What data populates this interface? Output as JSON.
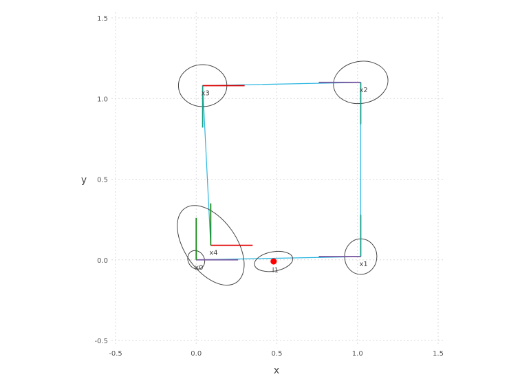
{
  "chart_data": {
    "type": "scatter",
    "title": "",
    "xlabel": "x",
    "ylabel": "y",
    "xlim": [
      -0.5,
      1.5
    ],
    "ylim": [
      -0.5,
      1.5
    ],
    "xticks": [
      -0.5,
      0.0,
      0.5,
      1.0,
      1.5
    ],
    "yticks": [
      -0.5,
      0.0,
      0.5,
      1.0,
      1.5
    ],
    "xtick_labels": [
      "-0.5",
      "0.0",
      "0.5",
      "1.0",
      "1.5"
    ],
    "ytick_labels": [
      "-0.5",
      "0.0",
      "0.5",
      "1.0",
      "1.5"
    ],
    "grid": true,
    "trajectory_color": "#29b6e0",
    "ellipse_color": "#444444",
    "axis_colors": {
      "x_axis": "#e00000",
      "y_axis": "#1a8a1a",
      "blend": "#7a5aa0",
      "teal": "#14a08a"
    },
    "poses": [
      {
        "label": "x0",
        "x": 0.0,
        "y": 0.0,
        "theta_deg": 0,
        "cov_rx": 0.05,
        "cov_ry": 0.06,
        "cov_rot_deg": 30
      },
      {
        "label": "x1",
        "x": 1.02,
        "y": 0.02,
        "theta_deg": 90,
        "cov_rx": 0.1,
        "cov_ry": 0.11,
        "cov_rot_deg": 0
      },
      {
        "label": "x2",
        "x": 1.02,
        "y": 1.1,
        "theta_deg": 180,
        "cov_rx": 0.17,
        "cov_ry": 0.13,
        "cov_rot_deg": 10
      },
      {
        "label": "x3",
        "x": 0.04,
        "y": 1.08,
        "theta_deg": 270,
        "cov_rx": 0.15,
        "cov_ry": 0.13,
        "cov_rot_deg": 0
      },
      {
        "label": "x4",
        "x": 0.09,
        "y": 0.09,
        "theta_deg": 0,
        "cov_rx": 0.16,
        "cov_ry": 0.28,
        "cov_rot_deg": 35
      }
    ],
    "landmarks": [
      {
        "label": "l1",
        "x": 0.48,
        "y": -0.01,
        "color": "#ff0000",
        "cov_rx": 0.12,
        "cov_ry": 0.06,
        "cov_rot_deg": 10
      }
    ]
  }
}
